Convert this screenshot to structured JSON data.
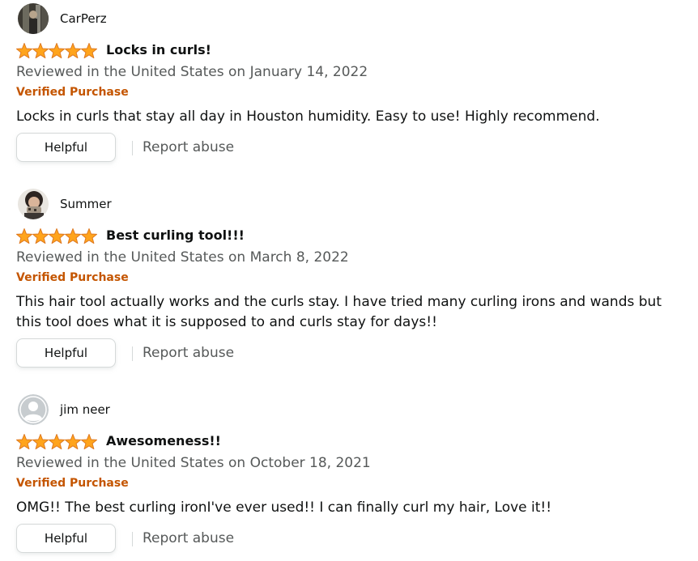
{
  "reviews": [
    {
      "profile_name": "CarPerz",
      "avatar_icon": "user-photo-icon",
      "rating": 5,
      "rating_max": 5,
      "title": "Locks in curls!",
      "date_line": "Reviewed in the United States on January 14, 2022",
      "verified_label": "Verified Purchase",
      "body": "Locks in curls that stay all day in Houston humidity. Easy to use! Highly recommend.",
      "helpful_label": "Helpful",
      "report_label": "Report abuse"
    },
    {
      "profile_name": "Summer",
      "avatar_icon": "user-photo-icon",
      "rating": 5,
      "rating_max": 5,
      "title": "Best curling tool!!!",
      "date_line": "Reviewed in the United States on March 8, 2022",
      "verified_label": "Verified Purchase",
      "body": "This hair tool actually works and the curls stay. I have tried many curling irons and wands but this tool does what it is supposed to and curls stay for days!!",
      "helpful_label": "Helpful",
      "report_label": "Report abuse"
    },
    {
      "profile_name": "jim neer",
      "avatar_icon": "default-avatar-icon",
      "rating": 5,
      "rating_max": 5,
      "title": "Awesomeness!!",
      "date_line": "Reviewed in the United States on October 18, 2021",
      "verified_label": "Verified Purchase",
      "body": "OMG!! The best curling ironI've ever used!! I can finally curl my hair, Love it!!",
      "helpful_label": "Helpful",
      "report_label": "Report abuse"
    }
  ],
  "colors": {
    "star_fill": "#ffa41c",
    "star_stroke": "#de7921",
    "verified": "#c45500",
    "muted_text": "#565959"
  }
}
